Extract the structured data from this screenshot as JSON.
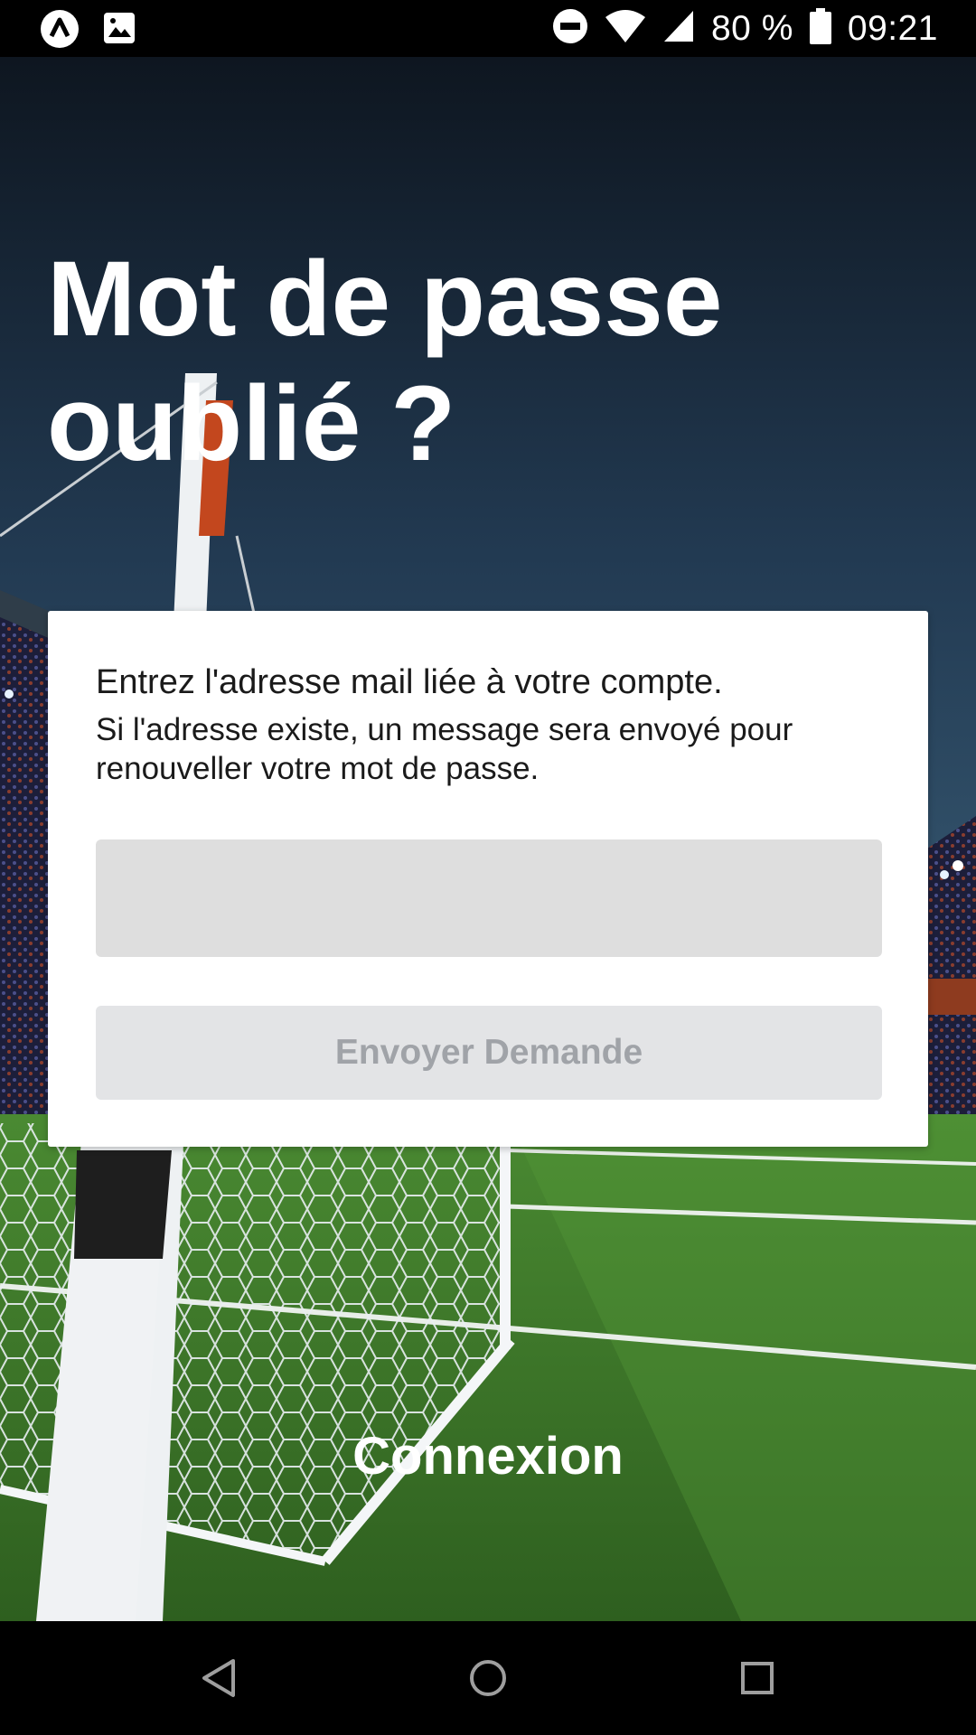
{
  "status_bar": {
    "battery_percent": "80 %",
    "time": "09:21",
    "left_icons": [
      "app-logo-icon",
      "image-notification-icon"
    ],
    "right_icons": [
      "do-not-disturb-icon",
      "wifi-icon",
      "cell-signal-icon",
      "battery-icon"
    ]
  },
  "page": {
    "title_line1": "Mot de passe",
    "title_line2": "oublié ?"
  },
  "card": {
    "instruction_primary": "Entrez l'adresse mail liée à votre compte.",
    "instruction_secondary": "Si l'adresse existe, un message sera envoyé pour renouveller votre mot de passe.",
    "email_value": "",
    "email_placeholder": "",
    "submit_label": "Envoyer Demande"
  },
  "footer": {
    "login_label": "Connexion"
  },
  "nav_bar": {
    "buttons": [
      "back-icon",
      "home-icon",
      "recents-icon"
    ]
  },
  "colors": {
    "card_bg": "#ffffff",
    "input_bg": "#dedede",
    "button_bg": "#e3e4e6",
    "button_text": "#a0a3a8",
    "sky_top": "#0e1620",
    "sky_bottom": "#2b4a64",
    "grass": "#3f7a2b"
  }
}
